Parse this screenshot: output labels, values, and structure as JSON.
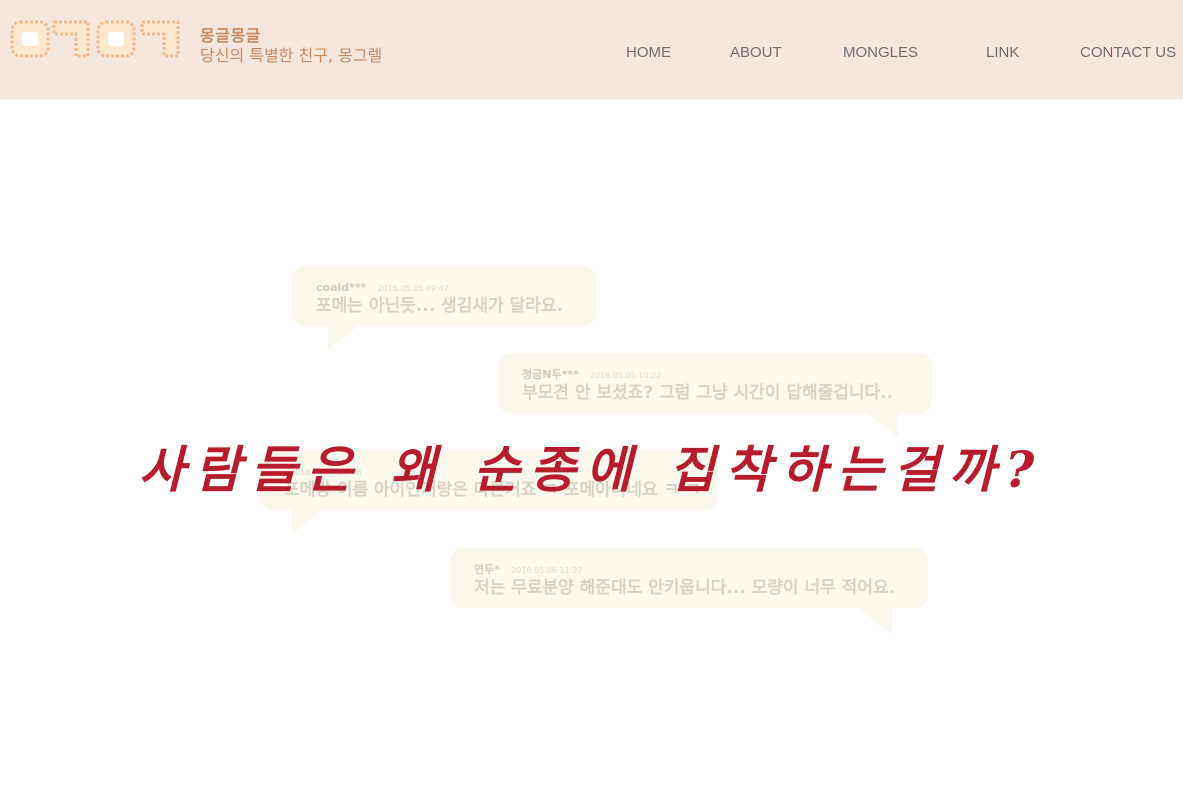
{
  "header": {
    "logo": {
      "text": "몽글"
    },
    "brand_title": "몽글몽글",
    "brand_subtitle": "당신의 특별한 친구, 몽그렐"
  },
  "nav": {
    "items": [
      {
        "label": "HOME"
      },
      {
        "label": "ABOUT"
      },
      {
        "label": "MONGLES"
      },
      {
        "label": "LINK"
      },
      {
        "label": "CONTACT US"
      }
    ]
  },
  "comments": [
    {
      "user": "coald***",
      "date": "2016.05.05 09:47",
      "text": "포메는 아닌듯... 생김새가 달라요."
    },
    {
      "user": "정금N두***",
      "date": "2016.05.05 10:22",
      "text": "부모견 안 보셨죠? 그럼 그냥 시간이 답해줄겁니다.."
    },
    {
      "user": "",
      "date": "2016.05.05 16:08",
      "text": "포메랑 이름 아이인거랑은 다른거죠 ㅋ 포메아니네요 ㅋ ㅋ"
    },
    {
      "user": "연두*",
      "date": "2016.05.06 11:27",
      "text": "저는 무료분양 해준대도 안키웁니다... 모량이 너무 적어요."
    }
  ],
  "headline": "사람들은 왜 순종에 집착하는걸까?",
  "colors": {
    "header_bg": "#f5e6de",
    "brand": "#c98a62",
    "headline": "#b71c2c",
    "bubble": "#fbf9ee"
  }
}
